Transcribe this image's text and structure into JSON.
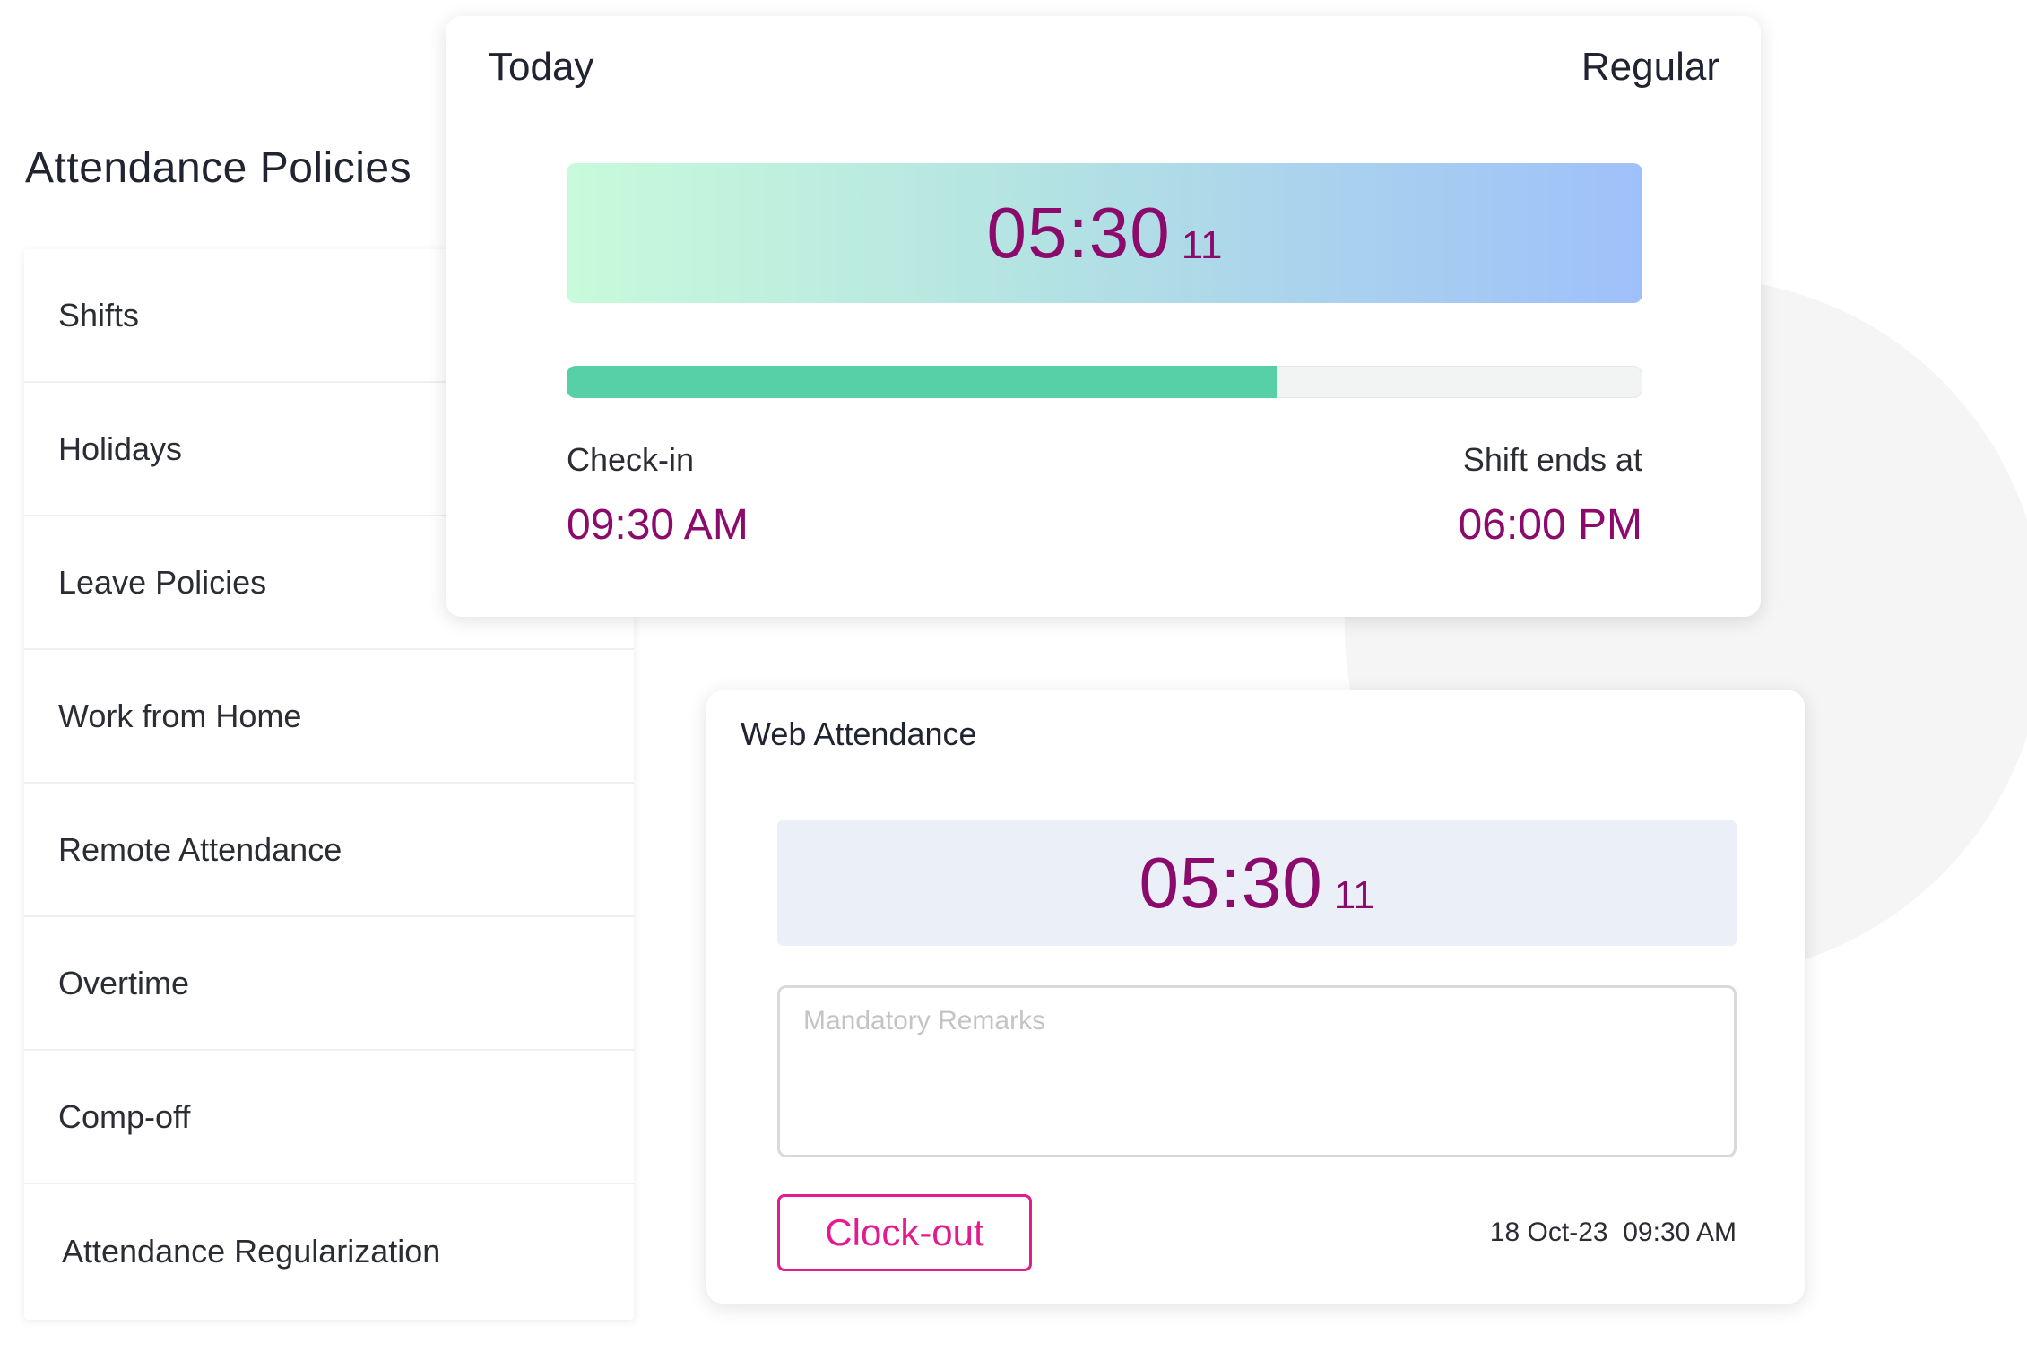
{
  "policies": {
    "title": "Attendance Policies",
    "items": [
      {
        "label": "Shifts"
      },
      {
        "label": "Holidays"
      },
      {
        "label": "Leave Policies"
      },
      {
        "label": "Work from Home"
      },
      {
        "label": "Remote Attendance"
      },
      {
        "label": "Overtime"
      },
      {
        "label": "Comp-off"
      },
      {
        "label": "Attendance Regularization"
      }
    ]
  },
  "today_card": {
    "title": "Today",
    "shift_type": "Regular",
    "timer": {
      "main": "05:30",
      "seconds": "11"
    },
    "progress": 0.66,
    "checkin_label": "Check-in",
    "checkin_value": "09:30 AM",
    "shift_end_label": "Shift ends at",
    "shift_end_value": "06:00 PM"
  },
  "web_attendance": {
    "title": "Web Attendance",
    "timer": {
      "main": "05:30",
      "seconds": "11"
    },
    "remarks_placeholder": "Mandatory Remarks",
    "remarks_value": "",
    "clockout_label": "Clock-out",
    "timestamp": "18 Oct-23  09:30 AM"
  },
  "colors": {
    "accent": "#8b0a6b",
    "button": "#e41b8e",
    "progress": "#58d0a7"
  }
}
